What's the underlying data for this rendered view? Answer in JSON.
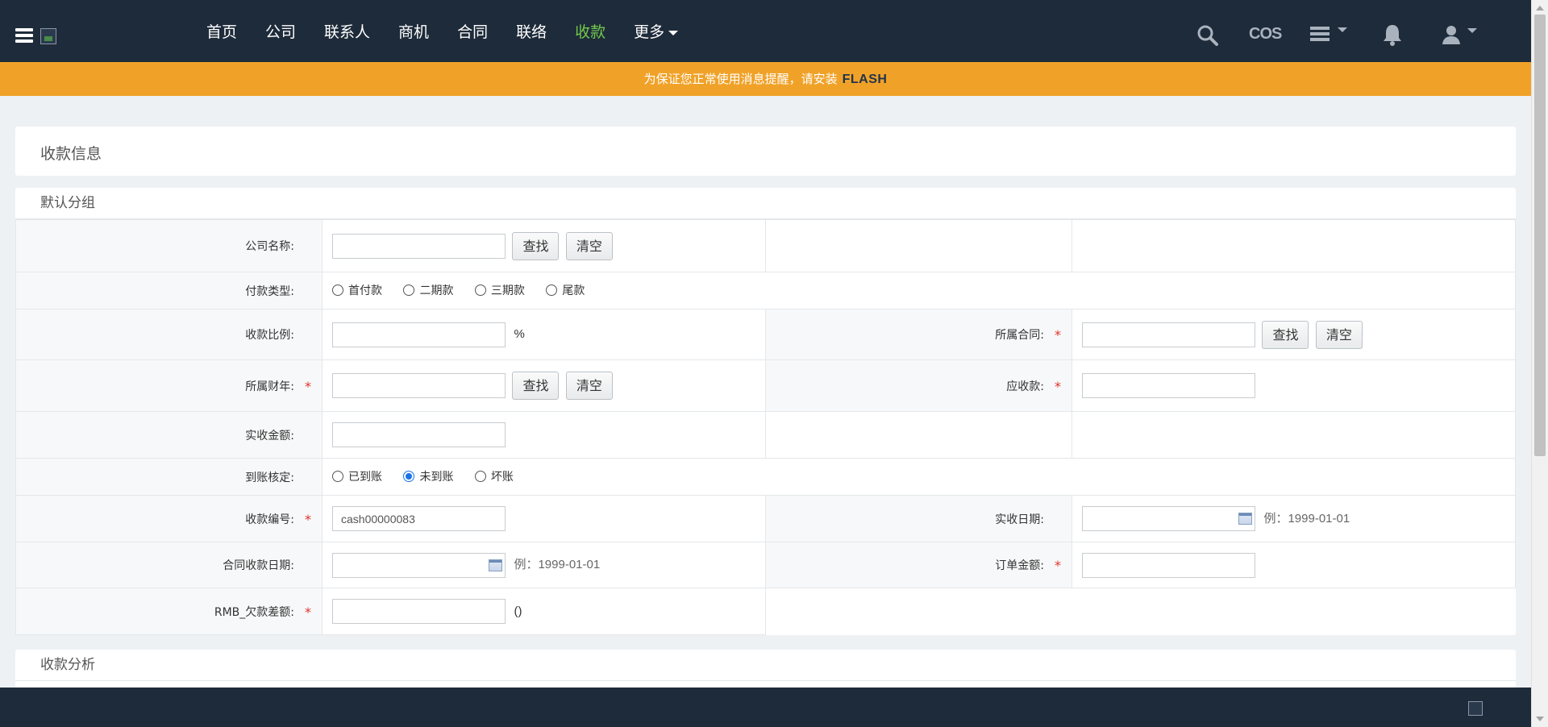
{
  "nav": {
    "items": [
      {
        "label": "首页",
        "active": false
      },
      {
        "label": "公司",
        "active": false
      },
      {
        "label": "联系人",
        "active": false
      },
      {
        "label": "商机",
        "active": false
      },
      {
        "label": "合同",
        "active": false
      },
      {
        "label": "联络",
        "active": false
      },
      {
        "label": "收款",
        "active": true
      },
      {
        "label": "更多",
        "active": false,
        "dropdown": true
      }
    ],
    "right_icons": [
      "search-icon",
      "cos-icon",
      "list-menu-icon",
      "bell-icon",
      "user-icon"
    ],
    "cos_label": "COS"
  },
  "banner": {
    "text": "为保证您正常使用消息提醒，请安装",
    "link": "FLASH"
  },
  "page": {
    "title": "收款信息",
    "group_title": "默认分组",
    "analysis_title": "收款分析"
  },
  "form": {
    "company_name_label": "公司名称:",
    "payment_type_label": "付款类型:",
    "payment_types": [
      "首付款",
      "二期款",
      "三期款",
      "尾款"
    ],
    "ratio_label": "收款比例:",
    "ratio_unit": "%",
    "contract_label": "所属合同:",
    "fiscal_year_label": "所属财年:",
    "receivable_label": "应收款:",
    "actual_amount_label": "实收金额:",
    "arrival_label": "到账核定:",
    "arrival_options": [
      "已到账",
      "未到账",
      "坏账"
    ],
    "arrival_selected": "未到账",
    "number_label": "收款编号:",
    "number_value": "cash00000083",
    "actual_date_label": "实收日期:",
    "date_hint": "例：1999-01-01",
    "contract_date_label": "合同收款日期:",
    "order_amount_label": "订单金额:",
    "rmb_diff_label": "RMB_欠款差额:",
    "rmb_diff_unit": "()",
    "find_button": "查找",
    "clear_button": "清空",
    "required_mark": "*"
  },
  "colors": {
    "nav_bg": "#1e2b3a",
    "active_nav": "#73c94c",
    "banner_bg": "#f0a228",
    "required": "#e2322c"
  }
}
